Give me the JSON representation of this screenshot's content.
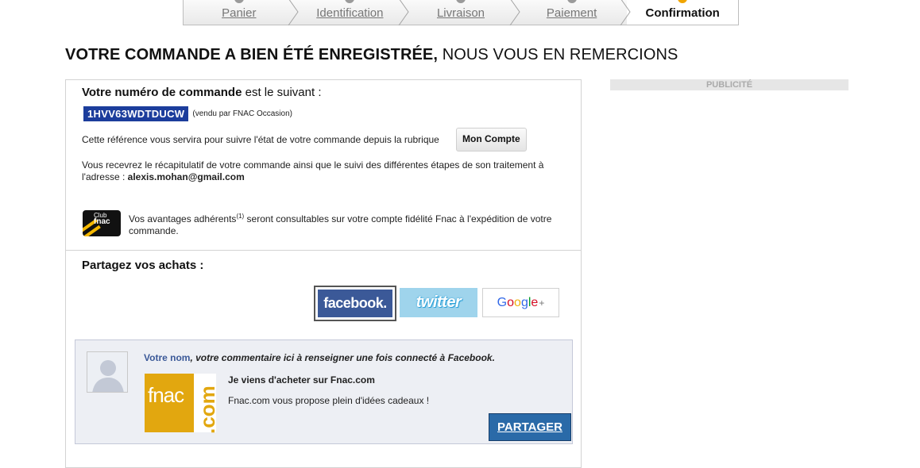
{
  "steps": [
    {
      "label": "Panier",
      "state": "done"
    },
    {
      "label": "Identification",
      "state": "done"
    },
    {
      "label": "Livraison",
      "state": "done"
    },
    {
      "label": "Paiement",
      "state": "done"
    },
    {
      "label": "Confirmation",
      "state": "active"
    }
  ],
  "headline": {
    "bold": "VOTRE COMMANDE A BIEN ÉTÉ ENREGISTRÉE,",
    "normal": " NOUS VOUS EN REMERCIONS"
  },
  "ad": {
    "label": "PUBLICITÉ"
  },
  "order": {
    "title_bold": "Votre numéro de commande",
    "title_rest": " est le suivant :",
    "number": "1HVV63WDTDUCW",
    "sold_by": "(vendu par FNAC Occasion)",
    "reference_text": "Cette référence vous servira pour suivre l'état de votre commande depuis la rubrique",
    "account_button": "Mon Compte",
    "recap_text": "Vous recevrez le récapitulatif de votre commande ainsi que le suivi des différentes étapes de son traitement à l'adresse : ",
    "email": "alexis.mohan@gmail.com"
  },
  "club": {
    "logo_line1": "Club",
    "logo_line2": "fnac",
    "text_before": "Vos avantages adhérents",
    "footnote": "(1)",
    "text_after": " seront consultables sur votre compte fidélité Fnac à l'expédition de votre commande."
  },
  "share": {
    "title": "Partagez vos achats :",
    "facebook_label": "facebook.",
    "twitter_label": "twitter",
    "google_letters": [
      "G",
      "o",
      "o",
      "g",
      "l",
      "e"
    ],
    "google_plus": "+"
  },
  "facebook_box": {
    "name": "Votre nom",
    "comment": ", votre commentaire ici à renseigner une fois connecté à Facebook.",
    "logo_word": "fnac",
    "logo_suffix": ".com",
    "post_title": "Je viens d'acheter sur Fnac.com",
    "post_desc": "Fnac.com vous propose plein d'idées cadeaux !",
    "button": "PARTAGER"
  },
  "colors": {
    "order_number_bg": "#1c3d9c",
    "facebook_blue": "#3b5998",
    "twitter_bg": "#9fd4ec",
    "fnac_yellow": "#e2a70f",
    "share_button": "#2a6aa8",
    "step_active_dot": "#f0a500"
  }
}
